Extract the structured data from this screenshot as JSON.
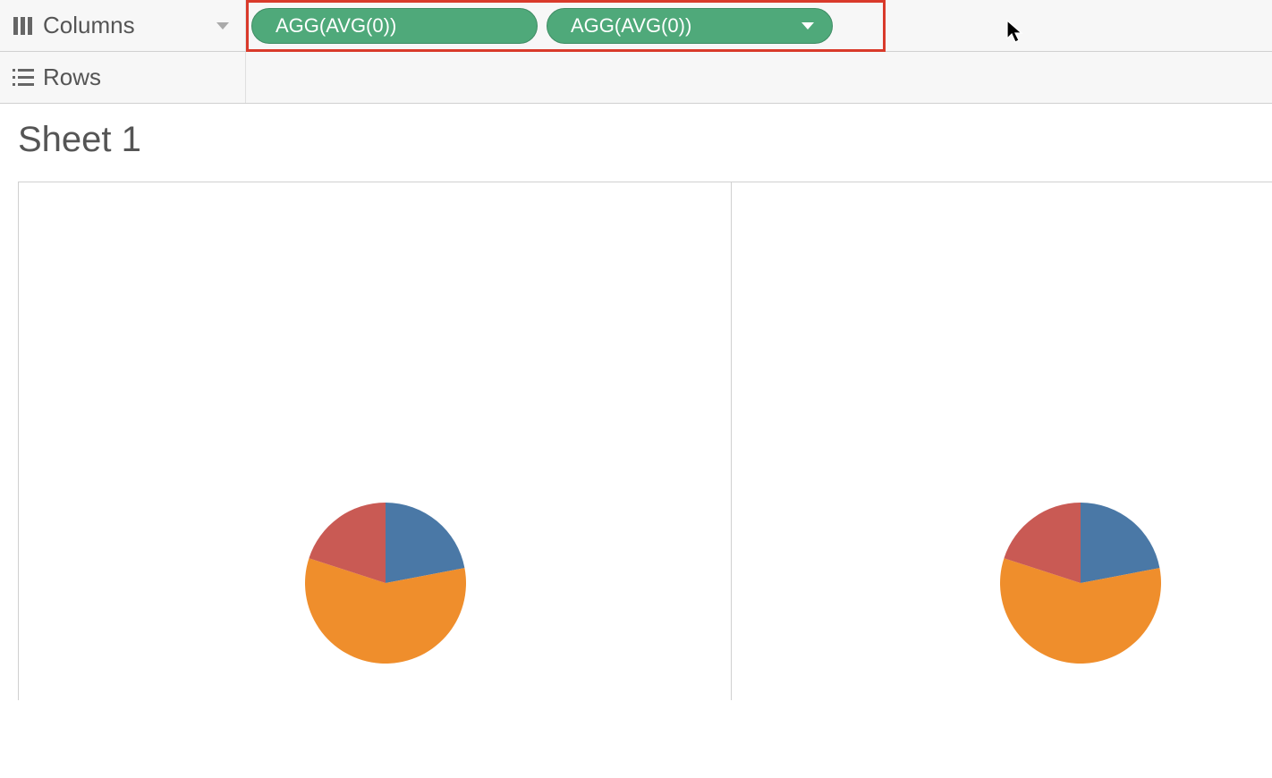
{
  "shelves": {
    "columns_label": "Columns",
    "rows_label": "Rows",
    "pills": [
      {
        "label": "AGG(AVG(0))"
      },
      {
        "label": "AGG(AVG(0))"
      }
    ]
  },
  "sheet": {
    "title": "Sheet 1"
  },
  "colors": {
    "pill_bg": "#4fa97a",
    "highlight": "#d93a2b",
    "pie_blue": "#4a78a6",
    "pie_orange": "#ef8e2c",
    "pie_red": "#c95a54"
  },
  "chart_data": [
    {
      "type": "pie",
      "series": [
        {
          "name": "Blue",
          "value": 22,
          "color": "#4a78a6"
        },
        {
          "name": "Orange",
          "value": 58,
          "color": "#ef8e2c"
        },
        {
          "name": "Red",
          "value": 20,
          "color": "#c95a54"
        }
      ]
    },
    {
      "type": "pie",
      "series": [
        {
          "name": "Blue",
          "value": 22,
          "color": "#4a78a6"
        },
        {
          "name": "Orange",
          "value": 58,
          "color": "#ef8e2c"
        },
        {
          "name": "Red",
          "value": 20,
          "color": "#c95a54"
        }
      ]
    }
  ]
}
